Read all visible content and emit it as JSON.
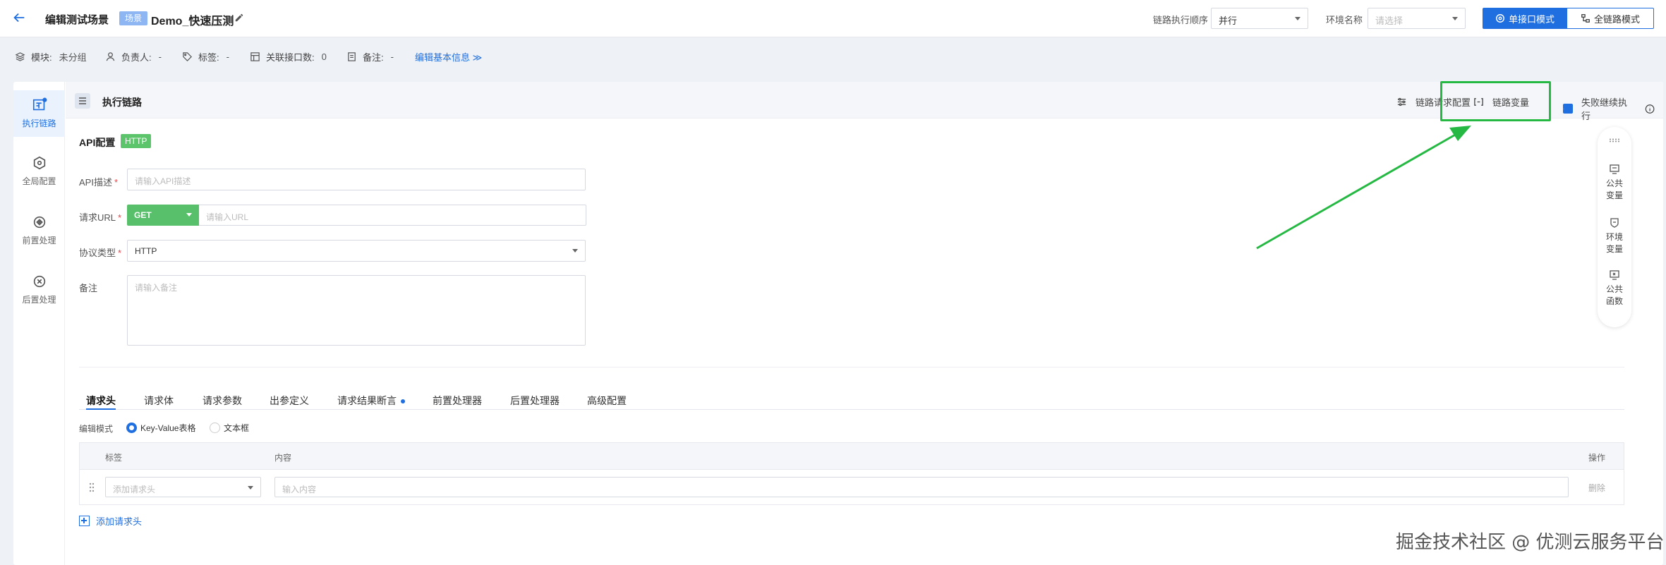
{
  "header": {
    "page_title": "编辑测试场景",
    "scene_tag": "场景",
    "scene_name": "Demo_快速压测",
    "order_label": "链路执行顺序",
    "order_value": "并行",
    "env_label": "环境名称",
    "env_placeholder": "请选择",
    "mode_single": "单接口模式",
    "mode_full": "全链路模式"
  },
  "info": {
    "module_label": "模块:",
    "module_value": "未分组",
    "owner_label": "负责人:",
    "owner_value": "-",
    "tag_label": "标签:",
    "tag_value": "-",
    "api_count_label": "关联接口数:",
    "api_count_value": "0",
    "remark_label": "备注:",
    "remark_value": "-",
    "edit_link": "编辑基本信息 ≫"
  },
  "nav": {
    "items": [
      {
        "label": "执行链路"
      },
      {
        "label": "全局配置"
      },
      {
        "label": "前置处理"
      },
      {
        "label": "后置处理"
      }
    ]
  },
  "chain": {
    "title": "执行链路",
    "request_config": "链路请求配置",
    "variables": "链路变量",
    "continue_on_fail": "失败继续执行"
  },
  "form": {
    "api_title": "API配置",
    "http_tag": "HTTP",
    "desc_label": "API描述",
    "desc_placeholder": "请输入API描述",
    "url_label": "请求URL",
    "method": "GET",
    "url_placeholder": "请输入URL",
    "protocol_label": "协议类型",
    "protocol_value": "HTTP",
    "remark_label": "备注",
    "remark_placeholder": "请输入备注",
    "required_mark": "*"
  },
  "tabs": [
    {
      "label": "请求头"
    },
    {
      "label": "请求体"
    },
    {
      "label": "请求参数"
    },
    {
      "label": "出参定义"
    },
    {
      "label": "请求结果断言"
    },
    {
      "label": "前置处理器"
    },
    {
      "label": "后置处理器"
    },
    {
      "label": "高级配置"
    }
  ],
  "edit_mode": {
    "label": "编辑模式",
    "option_kv": "Key-Value表格",
    "option_text": "文本框"
  },
  "table": {
    "col_tag": "标签",
    "col_content": "内容",
    "col_action": "操作",
    "row_key_placeholder": "添加请求头",
    "row_value_placeholder": "输入内容",
    "row_delete": "删除",
    "add_row": "添加请求头"
  },
  "float_panel": {
    "items": [
      {
        "label1": "公共",
        "label2": "变量"
      },
      {
        "label1": "环境",
        "label2": "变量"
      },
      {
        "label1": "公共",
        "label2": "函数"
      }
    ]
  },
  "watermark": "掘金技术社区 @ 优测云服务平台",
  "colors": {
    "primary": "#1f6fe0",
    "http_green": "#5cc46a",
    "highlight_green": "#25b943"
  }
}
